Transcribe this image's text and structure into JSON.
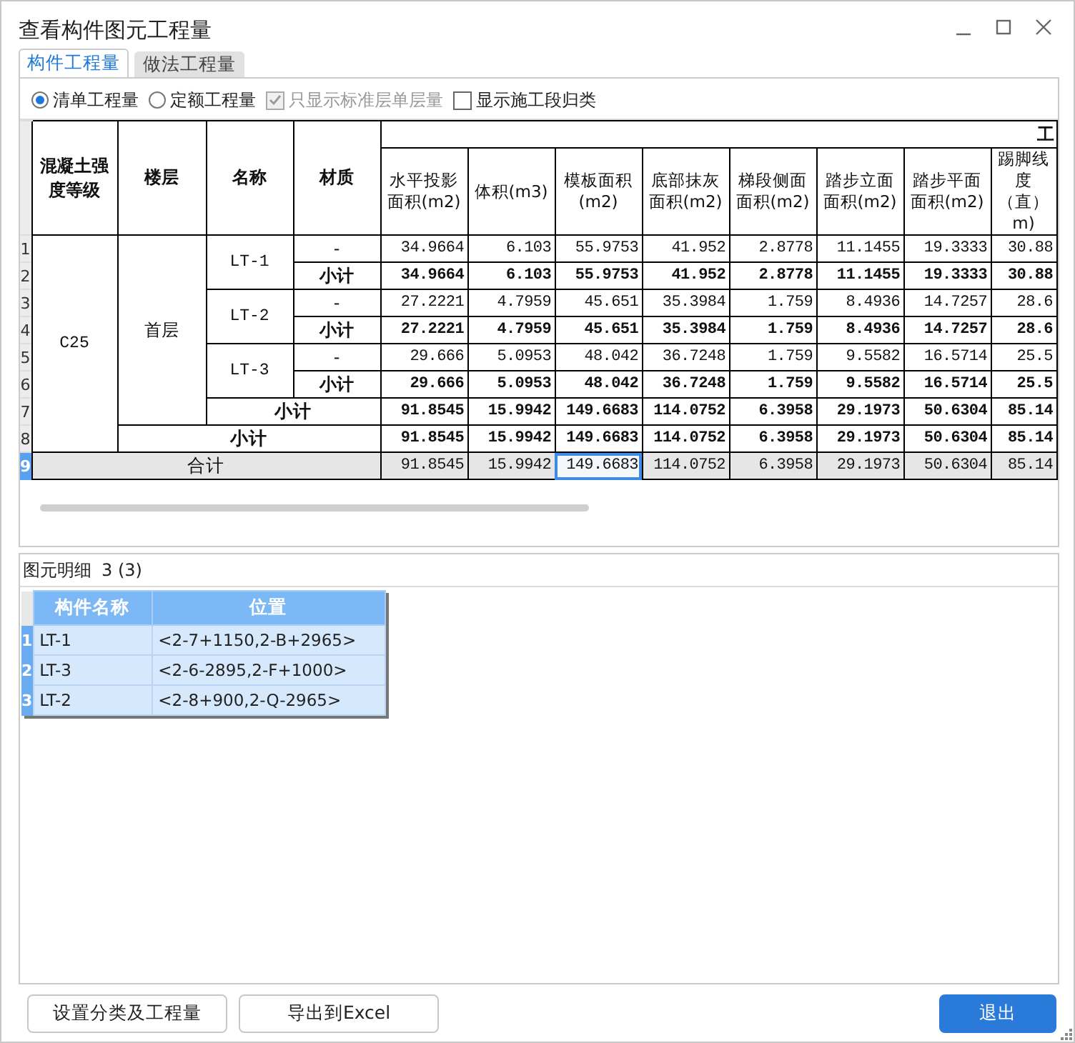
{
  "window": {
    "title": "查看构件图元工程量"
  },
  "tabs": [
    {
      "label": "构件工程量",
      "selected": true
    },
    {
      "label": "做法工程量",
      "selected": false
    }
  ],
  "options": [
    {
      "kind": "radio",
      "label": "清单工程量",
      "selected": true,
      "disabled": false
    },
    {
      "kind": "radio",
      "label": "定额工程量",
      "selected": false,
      "disabled": false
    },
    {
      "kind": "checkbox",
      "label": "只显示标准层单层量",
      "selected": true,
      "disabled": true
    },
    {
      "kind": "checkbox",
      "label": "显示施工段归类",
      "selected": false,
      "disabled": false
    }
  ],
  "table": {
    "group_header": "工",
    "key_columns": [
      "混凝土强度等级",
      "楼层",
      "名称",
      "材质"
    ],
    "value_columns": [
      "水平投影面积(m2)",
      "体积(m3)",
      "模板面积(m2)",
      "底部抹灰面积(m2)",
      "梯段侧面面积(m2)",
      "踏步立面面积(m2)",
      "踏步平面面积(m2)",
      "踢脚线度（直）m)"
    ],
    "grades": [
      {
        "grade": "C25",
        "floors": [
          {
            "floor": "首层",
            "components": [
              {
                "name": "LT-1",
                "lines": [
                  {
                    "num": "1",
                    "material": "-",
                    "kind": "item",
                    "selected": false,
                    "values": [
                      "34.9664",
                      "6.103",
                      "55.9753",
                      "41.952",
                      "2.8778",
                      "11.1455",
                      "19.3333",
                      "30.88"
                    ]
                  },
                  {
                    "num": "2",
                    "material": "小计",
                    "kind": "subtotal",
                    "selected": false,
                    "values": [
                      "34.9664",
                      "6.103",
                      "55.9753",
                      "41.952",
                      "2.8778",
                      "11.1455",
                      "19.3333",
                      "30.88"
                    ]
                  }
                ]
              },
              {
                "name": "LT-2",
                "lines": [
                  {
                    "num": "3",
                    "material": "-",
                    "kind": "item",
                    "selected": false,
                    "values": [
                      "27.2221",
                      "4.7959",
                      "45.651",
                      "35.3984",
                      "1.759",
                      "8.4936",
                      "14.7257",
                      "28.6"
                    ]
                  },
                  {
                    "num": "4",
                    "material": "小计",
                    "kind": "subtotal",
                    "selected": false,
                    "values": [
                      "27.2221",
                      "4.7959",
                      "45.651",
                      "35.3984",
                      "1.759",
                      "8.4936",
                      "14.7257",
                      "28.6"
                    ]
                  }
                ]
              },
              {
                "name": "LT-3",
                "lines": [
                  {
                    "num": "5",
                    "material": "-",
                    "kind": "item",
                    "selected": false,
                    "values": [
                      "29.666",
                      "5.0953",
                      "48.042",
                      "36.7248",
                      "1.759",
                      "9.5582",
                      "16.5714",
                      "25.5"
                    ]
                  },
                  {
                    "num": "6",
                    "material": "小计",
                    "kind": "subtotal",
                    "selected": false,
                    "values": [
                      "29.666",
                      "5.0953",
                      "48.042",
                      "36.7248",
                      "1.759",
                      "9.5582",
                      "16.5714",
                      "25.5"
                    ]
                  }
                ]
              }
            ],
            "subtotal": {
              "num": "7",
              "label": "小计",
              "selected": false,
              "values": [
                "91.8545",
                "15.9942",
                "149.6683",
                "114.0752",
                "6.3958",
                "29.1973",
                "50.6304",
                "85.14"
              ]
            }
          }
        ],
        "subtotal": {
          "num": "8",
          "label": "小计",
          "selected": false,
          "values": [
            "91.8545",
            "15.9942",
            "149.6683",
            "114.0752",
            "6.3958",
            "29.1973",
            "50.6304",
            "85.14"
          ]
        }
      }
    ],
    "total": {
      "num": "9",
      "label": "合计",
      "selected": true,
      "values": [
        {
          "text": "91.8545",
          "focused": false
        },
        {
          "text": "15.9942",
          "focused": false
        },
        {
          "text": "149.6683",
          "focused": true
        },
        {
          "text": "114.0752",
          "focused": false
        },
        {
          "text": "6.3958",
          "focused": false
        },
        {
          "text": "29.1973",
          "focused": false
        },
        {
          "text": "50.6304",
          "focused": false
        },
        {
          "text": "85.14",
          "focused": false
        }
      ]
    }
  },
  "details": {
    "title": "图元明细",
    "count": "3 (3)",
    "columns": [
      "构件名称",
      "位置"
    ],
    "rows": [
      {
        "num": "1",
        "name": "LT-1",
        "position": "<2-7+1150,2-B+2965>"
      },
      {
        "num": "2",
        "name": "LT-3",
        "position": "<2-6-2895,2-F+1000>"
      },
      {
        "num": "3",
        "name": "LT-2",
        "position": "<2-8+900,2-Q-2965>"
      }
    ]
  },
  "buttons": [
    {
      "label": "设置分类及工程量",
      "kind": "default"
    },
    {
      "label": "导出到Excel",
      "kind": "default"
    },
    {
      "label": "退出",
      "kind": "primary"
    }
  ]
}
